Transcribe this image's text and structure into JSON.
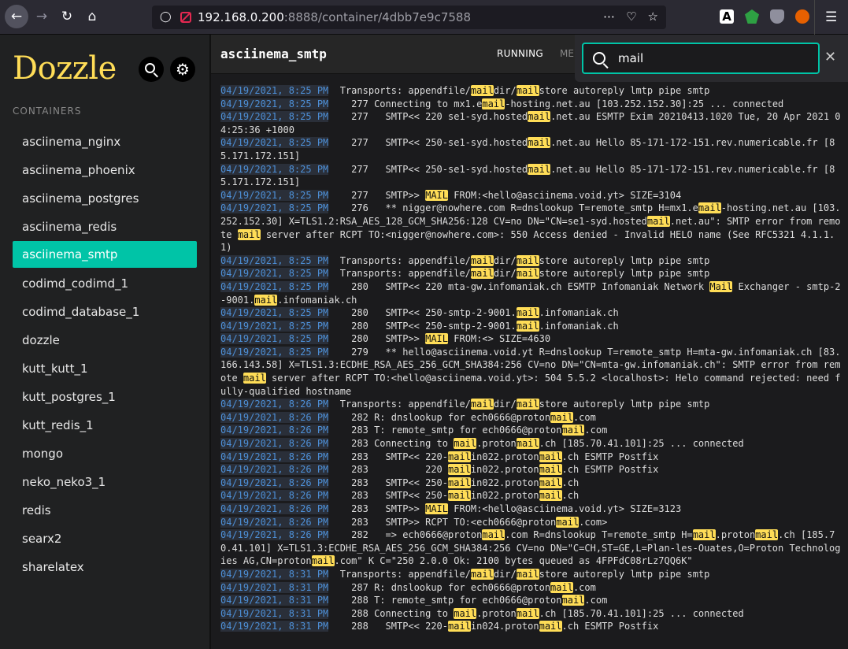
{
  "browser": {
    "url_host": "192.168.0.200",
    "url_rest": ":8888/container/4dbb7e9c7588",
    "ext_a_label": "A"
  },
  "sidebar": {
    "logo": "Dozzle",
    "section_label": "CONTAINERS",
    "active_index": 4,
    "containers": [
      "asciinema_nginx",
      "asciinema_phoenix",
      "asciinema_postgres",
      "asciinema_redis",
      "asciinema_smtp",
      "codimd_codimd_1",
      "codimd_database_1",
      "dozzle",
      "kutt_kutt_1",
      "kutt_postgres_1",
      "kutt_redis_1",
      "mongo",
      "neko_neko3_1",
      "redis",
      "searx2",
      "sharelatex"
    ]
  },
  "main": {
    "title": "asciinema_smtp",
    "status": "RUNNING",
    "mem": "ME"
  },
  "find": {
    "query": "mail"
  },
  "logs": [
    {
      "ts": "04/19/2021, 8:25 PM",
      "msg": "  Transports: appendfile/maildir/mailstore autoreply lmtp pipe smtp"
    },
    {
      "ts": "04/19/2021, 8:25 PM",
      "msg": "    277 Connecting to mx1.email-hosting.net.au [103.252.152.30]:25 ... connected"
    },
    {
      "ts": "04/19/2021, 8:25 PM",
      "msg": "    277   SMTP<< 220 se1-syd.hostedmail.net.au ESMTP Exim 20210413.1020 Tue, 20 Apr 2021 04:25:36 +1000"
    },
    {
      "ts": "04/19/2021, 8:25 PM",
      "msg": "    277   SMTP<< 250-se1-syd.hostedmail.net.au Hello 85-171-172-151.rev.numericable.fr [85.171.172.151]"
    },
    {
      "ts": "04/19/2021, 8:25 PM",
      "msg": "    277   SMTP<< 250-se1-syd.hostedmail.net.au Hello 85-171-172-151.rev.numericable.fr [85.171.172.151]"
    },
    {
      "ts": "04/19/2021, 8:25 PM",
      "msg": "    277   SMTP>> MAIL FROM:<hello@asciinema.void.yt> SIZE=3104"
    },
    {
      "ts": "04/19/2021, 8:25 PM",
      "msg": "    276   ** nigger@nowhere.com R=dnslookup T=remote_smtp H=mx1.email-hosting.net.au [103.252.152.30] X=TLS1.2:RSA_AES_128_GCM_SHA256:128 CV=no DN=\"CN=se1-syd.hostedmail.net.au\": SMTP error from remote mail server after RCPT TO:<nigger@nowhere.com>: 550 Access denied - Invalid HELO name (See RFC5321 4.1.1.1)"
    },
    {
      "ts": "04/19/2021, 8:25 PM",
      "msg": "  Transports: appendfile/maildir/mailstore autoreply lmtp pipe smtp"
    },
    {
      "ts": "04/19/2021, 8:25 PM",
      "msg": "  Transports: appendfile/maildir/mailstore autoreply lmtp pipe smtp"
    },
    {
      "ts": "04/19/2021, 8:25 PM",
      "msg": "    280   SMTP<< 220 mta-gw.infomaniak.ch ESMTP Infomaniak Network Mail Exchanger - smtp-2-9001.mail.infomaniak.ch"
    },
    {
      "ts": "04/19/2021, 8:25 PM",
      "msg": "    280   SMTP<< 250-smtp-2-9001.mail.infomaniak.ch"
    },
    {
      "ts": "04/19/2021, 8:25 PM",
      "msg": "    280   SMTP<< 250-smtp-2-9001.mail.infomaniak.ch"
    },
    {
      "ts": "04/19/2021, 8:25 PM",
      "msg": "    280   SMTP>> MAIL FROM:<> SIZE=4630"
    },
    {
      "ts": "04/19/2021, 8:25 PM",
      "msg": "    279   ** hello@asciinema.void.yt R=dnslookup T=remote_smtp H=mta-gw.infomaniak.ch [83.166.143.58] X=TLS1.3:ECDHE_RSA_AES_256_GCM_SHA384:256 CV=no DN=\"CN=mta-gw.infomaniak.ch\": SMTP error from remote mail server after RCPT TO:<hello@asciinema.void.yt>: 504 5.5.2 <localhost>: Helo command rejected: need fully-qualified hostname"
    },
    {
      "ts": "04/19/2021, 8:26 PM",
      "msg": "  Transports: appendfile/maildir/mailstore autoreply lmtp pipe smtp"
    },
    {
      "ts": "04/19/2021, 8:26 PM",
      "msg": "    282 R: dnslookup for ech0666@protonmail.com"
    },
    {
      "ts": "04/19/2021, 8:26 PM",
      "msg": "    283 T: remote_smtp for ech0666@protonmail.com"
    },
    {
      "ts": "04/19/2021, 8:26 PM",
      "msg": "    283 Connecting to mail.protonmail.ch [185.70.41.101]:25 ... connected"
    },
    {
      "ts": "04/19/2021, 8:26 PM",
      "msg": "    283   SMTP<< 220-mailin022.protonmail.ch ESMTP Postfix"
    },
    {
      "ts": "04/19/2021, 8:26 PM",
      "msg": "    283          220 mailin022.protonmail.ch ESMTP Postfix"
    },
    {
      "ts": "04/19/2021, 8:26 PM",
      "msg": "    283   SMTP<< 250-mailin022.protonmail.ch"
    },
    {
      "ts": "04/19/2021, 8:26 PM",
      "msg": "    283   SMTP<< 250-mailin022.protonmail.ch"
    },
    {
      "ts": "04/19/2021, 8:26 PM",
      "msg": "    283   SMTP>> MAIL FROM:<hello@asciinema.void.yt> SIZE=3123"
    },
    {
      "ts": "04/19/2021, 8:26 PM",
      "msg": "    283   SMTP>> RCPT TO:<ech0666@protonmail.com>"
    },
    {
      "ts": "04/19/2021, 8:26 PM",
      "msg": "    282   => ech0666@protonmail.com R=dnslookup T=remote_smtp H=mail.protonmail.ch [185.70.41.101] X=TLS1.3:ECDHE_RSA_AES_256_GCM_SHA384:256 CV=no DN=\"C=CH,ST=GE,L=Plan-les-Ouates,O=Proton Technologies AG,CN=protonmail.com\" K C=\"250 2.0.0 Ok: 2100 bytes queued as 4FPFdC08rLz7QQ6K\""
    },
    {
      "ts": "04/19/2021, 8:31 PM",
      "msg": "  Transports: appendfile/maildir/mailstore autoreply lmtp pipe smtp"
    },
    {
      "ts": "04/19/2021, 8:31 PM",
      "msg": "    287 R: dnslookup for ech0666@protonmail.com"
    },
    {
      "ts": "04/19/2021, 8:31 PM",
      "msg": "    288 T: remote_smtp for ech0666@protonmail.com"
    },
    {
      "ts": "04/19/2021, 8:31 PM",
      "msg": "    288 Connecting to mail.protonmail.ch [185.70.41.101]:25 ... connected"
    },
    {
      "ts": "04/19/2021, 8:31 PM",
      "msg": "    288   SMTP<< 220-mailin024.protonmail.ch ESMTP Postfix"
    }
  ]
}
